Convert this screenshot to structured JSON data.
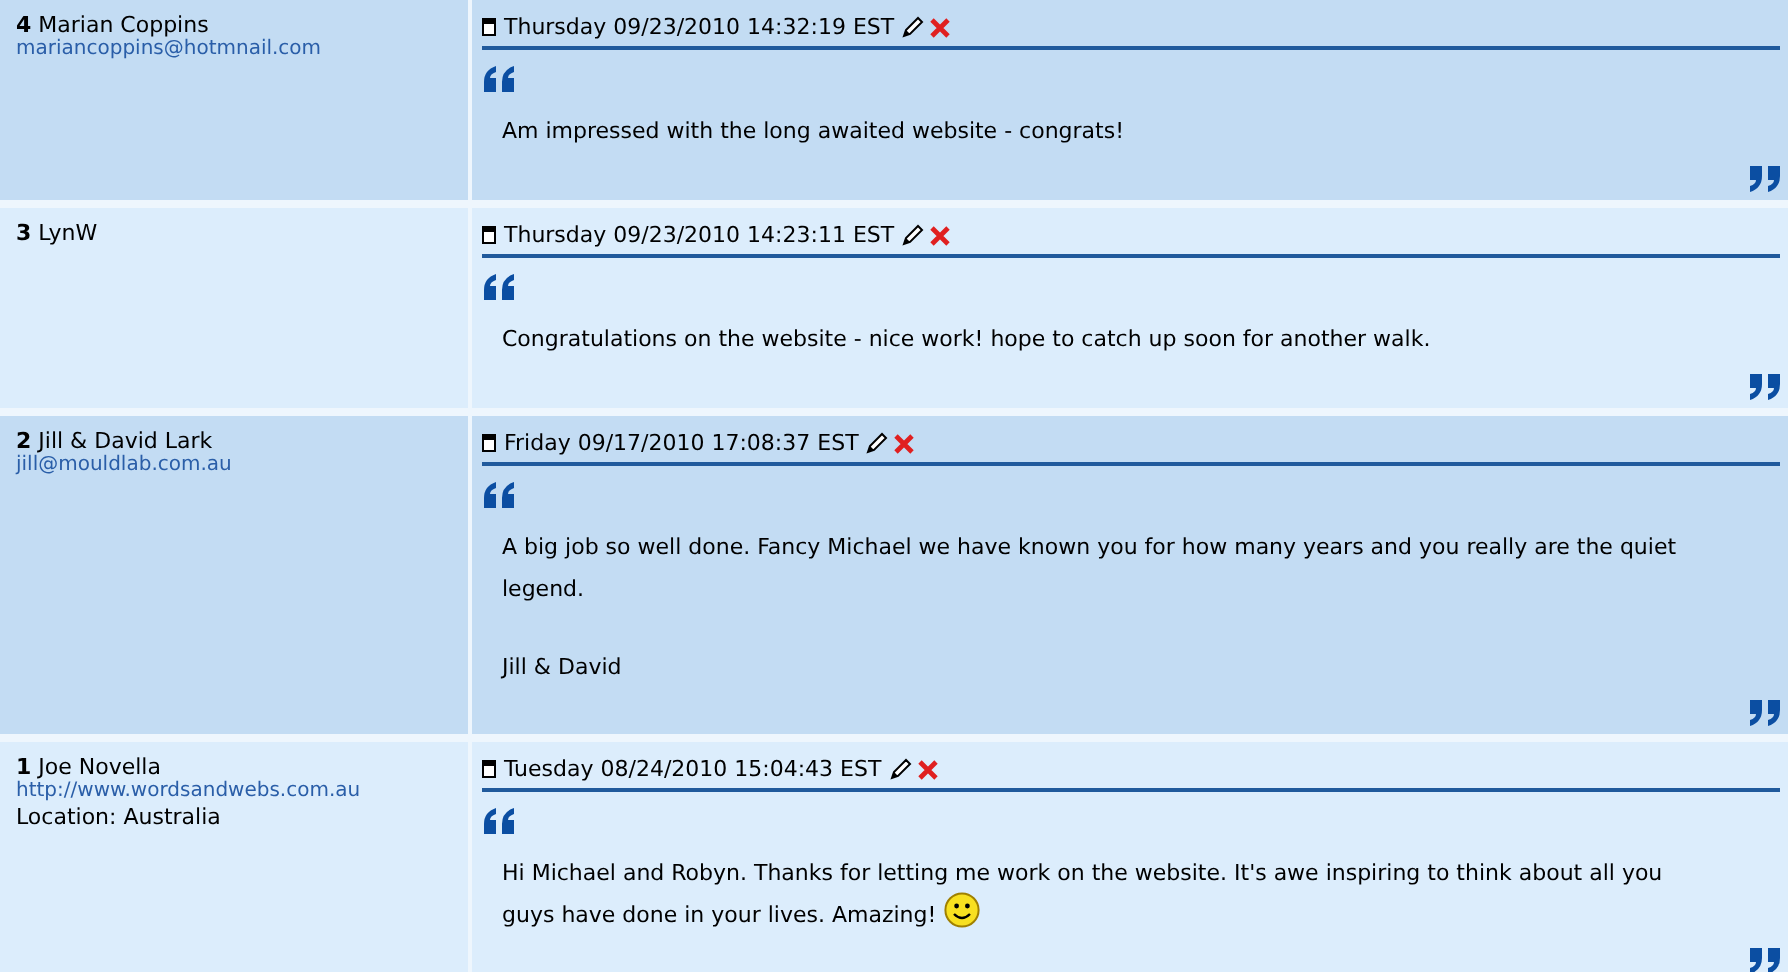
{
  "entries": [
    {
      "number": "4",
      "name": "Marian Coppins",
      "contact": "mariancoppins@hotmnail.com",
      "date": "Thursday 09/23/2010 14:32:19 EST",
      "paragraphs": [
        "Am impressed with the long awaited website - congrats!"
      ],
      "smiley": false
    },
    {
      "number": "3",
      "name": "LynW",
      "date": "Thursday 09/23/2010 14:23:11 EST",
      "paragraphs": [
        "Congratulations on the website - nice work! hope to catch up soon for another walk."
      ],
      "smiley": false
    },
    {
      "number": "2",
      "name": "Jill & David Lark",
      "contact": "jill@mouldlab.com.au",
      "date": "Friday 09/17/2010 17:08:37 EST",
      "paragraphs": [
        "A big job so well done. Fancy Michael we have known you for how many years and you really are the quiet legend.",
        "Jill & David"
      ],
      "smiley": false
    },
    {
      "number": "1",
      "name": "Joe Novella",
      "contact": "http://www.wordsandwebs.com.au",
      "location": "Location: Australia",
      "date": "Tuesday 08/24/2010 15:04:43 EST",
      "paragraphs": [
        "Hi Michael and Robyn. Thanks for letting me work on the website. It's awe inspiring to think about all you guys have done in your lives. Amazing!"
      ],
      "smiley": true
    }
  ]
}
